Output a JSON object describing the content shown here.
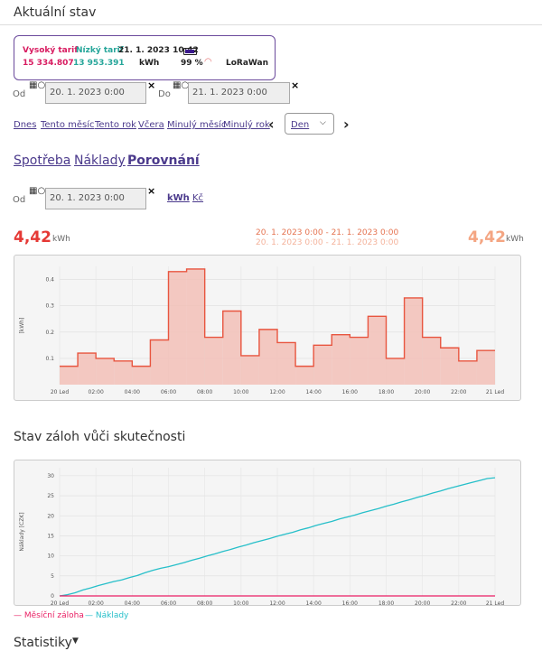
{
  "page_title": "Aktuální stav",
  "status_card": {
    "high_tariff_label": "Vysoký tarif",
    "low_tariff_label": "Nízký tarif",
    "datetime": "21. 1. 2023 10:42",
    "high_value": "15 334.807",
    "low_value": "13 953.391",
    "unit": "kWh",
    "battery": "99 %",
    "network": "LoRaWan",
    "colors": {
      "high": "#d81b60",
      "low": "#26a69a",
      "border": "#6b4a9c"
    }
  },
  "range1": {
    "from_label": "Od",
    "from_value": "20. 1. 2023 0:00",
    "to_label": "Do",
    "to_value": "21. 1. 2023 0:00",
    "clear": "×"
  },
  "quick_links": [
    "Dnes",
    "Tento měsíc",
    "Tento rok",
    "Včera",
    "Minulý měsíc",
    "Minulý rok"
  ],
  "nav": {
    "prev": "‹",
    "next": "›",
    "period": "Den"
  },
  "tabs": {
    "consumption": "Spotřeba",
    "costs": "Náklady",
    "comparison": "Porovnání"
  },
  "range2": {
    "from_label": "Od",
    "from_value": "20. 1. 2023 0:00",
    "clear": "×",
    "unit_kwh": "kWh",
    "unit_czk": "Kč"
  },
  "compare": {
    "left_value": "4,42",
    "left_unit": "kWh",
    "range_a": "20. 1. 2023 0:00 - 21. 1. 2023 0:00",
    "range_b": "20. 1. 2023 0:00 - 21. 1. 2023 0:00",
    "right_value": "4,42",
    "right_unit": "kWh",
    "colors": {
      "left": "#e53935",
      "right": "#f4a582"
    }
  },
  "section2_title": "Stav záloh vůči skutečnosti",
  "legend": {
    "monthly": "— Měsíční záloha",
    "costs": "— Náklady",
    "monthly_color": "#e91e63",
    "costs_color": "#26bfc9"
  },
  "stats_label": "Statistiky",
  "chart_data": [
    {
      "type": "area",
      "ylabel": "[kWh]",
      "ylim": [
        0,
        0.45
      ],
      "yticks": [
        0.1,
        0.2,
        0.3,
        0.4
      ],
      "xticks": [
        "20 Led",
        "02:00",
        "04:00",
        "06:00",
        "08:00",
        "10:00",
        "12:00",
        "14:00",
        "16:00",
        "18:00",
        "20:00",
        "22:00",
        "21 Led"
      ],
      "step": "hourly",
      "values": [
        0.07,
        0.12,
        0.1,
        0.09,
        0.07,
        0.17,
        0.43,
        0.44,
        0.18,
        0.28,
        0.11,
        0.21,
        0.16,
        0.07,
        0.15,
        0.19,
        0.18,
        0.26,
        0.1,
        0.33,
        0.18,
        0.14,
        0.09,
        0.13
      ],
      "colors": {
        "line": "#e8553f",
        "fill": "#f2c0b7"
      }
    },
    {
      "type": "line",
      "ylabel": "Náklady [CZK]",
      "ylim": [
        0,
        32
      ],
      "yticks": [
        0,
        5,
        10,
        15,
        20,
        25,
        30
      ],
      "xticks": [
        "20 Led",
        "02:00",
        "04:00",
        "06:00",
        "08:00",
        "10:00",
        "12:00",
        "14:00",
        "16:00",
        "18:00",
        "20:00",
        "22:00",
        "21 Led"
      ],
      "series": [
        {
          "name": "Náklady",
          "values": [
            0,
            0.3,
            0.8,
            1.5,
            2.0,
            2.6,
            3.1,
            3.6,
            4.0,
            4.6,
            5.1,
            5.8,
            6.4,
            6.9,
            7.3,
            7.8,
            8.3,
            8.9,
            9.4,
            10.0,
            10.5,
            11.1,
            11.6,
            12.2,
            12.7,
            13.3,
            13.8,
            14.3,
            14.9,
            15.4,
            15.9,
            16.5,
            17.0,
            17.6,
            18.1,
            18.6,
            19.2,
            19.7,
            20.2,
            20.8,
            21.3,
            21.8,
            22.4,
            22.9,
            23.5,
            24.0,
            24.6,
            25.1,
            25.7,
            26.2,
            26.8,
            27.3,
            27.8,
            28.3,
            28.8,
            29.3,
            29.5
          ]
        },
        {
          "name": "Měsíční záloha",
          "values": [
            0,
            0
          ]
        }
      ],
      "colors": {
        "costs": "#26bfc9",
        "monthly": "#e91e63"
      }
    }
  ]
}
